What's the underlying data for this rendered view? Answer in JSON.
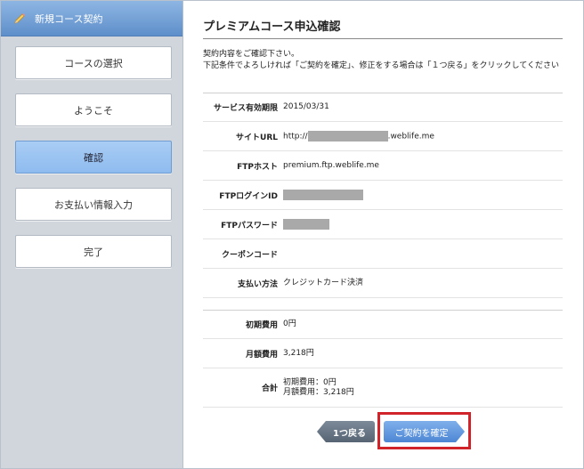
{
  "sidebar": {
    "title": "新規コース契約",
    "steps": [
      {
        "label": "コースの選択",
        "active": false
      },
      {
        "label": "ようこそ",
        "active": false
      },
      {
        "label": "確認",
        "active": true
      },
      {
        "label": "お支払い情報入力",
        "active": false
      },
      {
        "label": "完了",
        "active": false
      }
    ]
  },
  "main": {
    "title": "プレミアムコース申込確認",
    "intro_line1": "契約内容をご確認下さい。",
    "intro_line2": "下記条件でよろしければ「ご契約を確定」、修正をする場合は「１つ戻る」をクリックしてください",
    "details": {
      "expiry_label": "サービス有効期限",
      "expiry_value": "2015/03/31",
      "site_url_label": "サイトURL",
      "site_url_prefix": "http://",
      "site_url_suffix": ".weblife.me",
      "ftp_host_label": "FTPホスト",
      "ftp_host_value": "premium.ftp.weblife.me",
      "ftp_login_label": "FTPログインID",
      "ftp_password_label": "FTPパスワード",
      "coupon_label": "クーポンコード",
      "coupon_value": "",
      "payment_label": "支払い方法",
      "payment_value": "クレジットカード決済"
    },
    "fees": {
      "initial_label": "初期費用",
      "initial_value": "0円",
      "monthly_label": "月額費用",
      "monthly_value": "3,218円",
      "total_label": "合計",
      "total_line1": "初期費用：0円",
      "total_line2": "月額費用：3,218円"
    },
    "buttons": {
      "back_label": "1つ戻る",
      "confirm_label": "ご契約を確定"
    },
    "colors": {
      "accent": "#5e8fca",
      "highlight": "#d0232a"
    }
  }
}
